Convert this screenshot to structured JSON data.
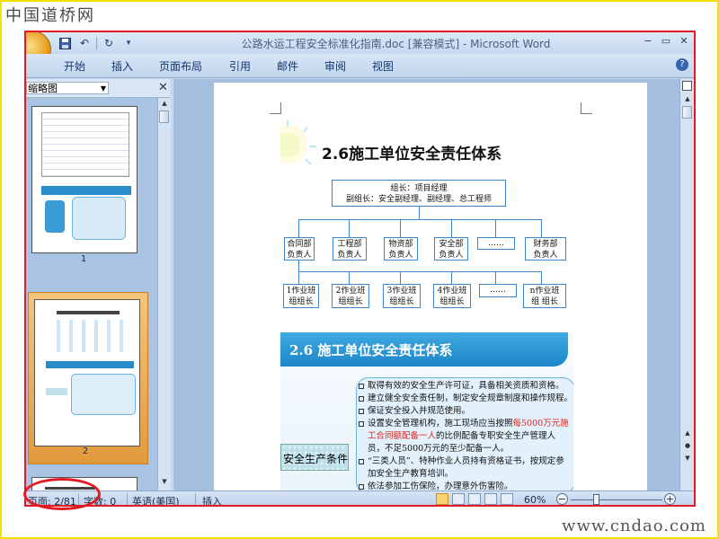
{
  "watermark": {
    "logo": "中国道桥网",
    "url": "www.cndao.com"
  },
  "window": {
    "title": "公路水运工程安全标准化指南.doc [兼容模式] - Microsoft Word",
    "controls": [
      "−",
      "▭",
      "✕"
    ],
    "help": "?"
  },
  "qat": {
    "save_icon": "save-icon",
    "undo_icon": "undo-icon",
    "redo_icon": "redo-icon"
  },
  "ribbon": {
    "tabs": [
      "开始",
      "插入",
      "页面布局",
      "引用",
      "邮件",
      "审阅",
      "视图"
    ]
  },
  "nav_pane": {
    "view_select": "缩略图",
    "close": "✕",
    "thumbnails": [
      {
        "number": "1"
      },
      {
        "number": "2"
      }
    ],
    "selected_page": 2
  },
  "document": {
    "slide1": {
      "title": "2.6施工单位安全责任体系",
      "top_box": [
        "组长：项目经理",
        "副组长：安全副经理、副经理、总工程师"
      ],
      "departments": [
        [
          "合同部",
          "负责人"
        ],
        [
          "工程部",
          "负责人"
        ],
        [
          "物资部",
          "负责人"
        ],
        [
          "安全部",
          "负责人"
        ],
        [
          "……",
          ""
        ],
        [
          "财务部",
          "负责人"
        ]
      ],
      "teams": [
        [
          "1作业班",
          "组组长"
        ],
        [
          "2作业班",
          "组组长"
        ],
        [
          "3作业班",
          "组组长"
        ],
        [
          "4作业班",
          "组组长"
        ],
        [
          "……",
          ""
        ],
        [
          "n作业班",
          "组 组长"
        ]
      ]
    },
    "slide2": {
      "banner": "2.6  施工单位安全责任体系",
      "tile_label": "安全生产条件",
      "items": [
        {
          "text": "取得有效的安全生产许可证，具备相关资质和资格。"
        },
        {
          "text": "建立健全安全责任制，制定安全规章制度和操作规程。"
        },
        {
          "text": "保证安全投入并规范使用。"
        },
        {
          "text_before": "设置安全管理机构，施工现场应当按照",
          "red1": "每5000万元",
          "red2": "施工合同额配备一人",
          "text_after": "的比例配备专职安全生产管理人员，不足5000万元的至少配备一人。"
        },
        {
          "text": "“三类人员”、特种作业人员持有资格证书，按规定参加安全生产教育培训。"
        },
        {
          "text": "依法参加工伤保险，办理意外伤害险。"
        }
      ]
    }
  },
  "statusbar": {
    "page": "页面: 2/81",
    "words": "字数: 0",
    "language": "英语(美国)",
    "mode": "插入",
    "zoom": "60%",
    "zoom_level_percent": 60,
    "zoom_minus": "−",
    "zoom_plus": "+"
  },
  "colors": {
    "annotation": "#e21b23",
    "frame": "#f2e200",
    "accent": "#1d86c9"
  }
}
